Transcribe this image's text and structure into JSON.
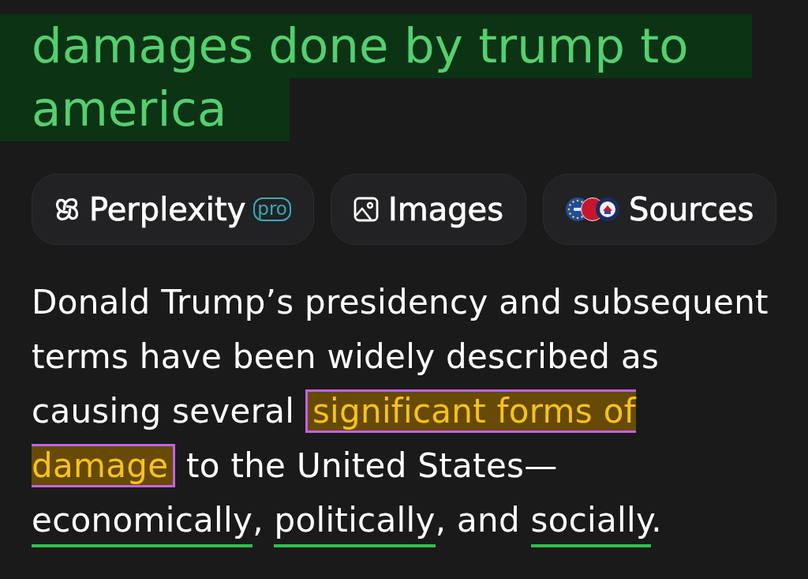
{
  "query": {
    "text": "damages done by trump to america",
    "highlighted": true
  },
  "actions": [
    {
      "kind": "perplexity",
      "label": "Perplexity",
      "badge": "pro"
    },
    {
      "kind": "images",
      "label": "Images"
    },
    {
      "kind": "sources",
      "label": "Sources"
    }
  ],
  "answer": {
    "segments": [
      {
        "text": "Donald Trump’s presidency and subsequent terms have been widely described as causing several ",
        "highlighted": false,
        "underlined": false
      },
      {
        "text": "significant forms of damage",
        "highlighted": true,
        "underlined": false
      },
      {
        "text": " to the United States—",
        "highlighted": false,
        "underlined": false
      },
      {
        "text": "economically",
        "highlighted": false,
        "underlined": true
      },
      {
        "text": ", ",
        "highlighted": false,
        "underlined": false
      },
      {
        "text": "politically",
        "highlighted": false,
        "underlined": true
      },
      {
        "text": ", and ",
        "highlighted": false,
        "underlined": false
      },
      {
        "text": "socially",
        "highlighted": false,
        "underlined": true
      },
      {
        "text": ".",
        "highlighted": false,
        "underlined": false
      }
    ]
  }
}
